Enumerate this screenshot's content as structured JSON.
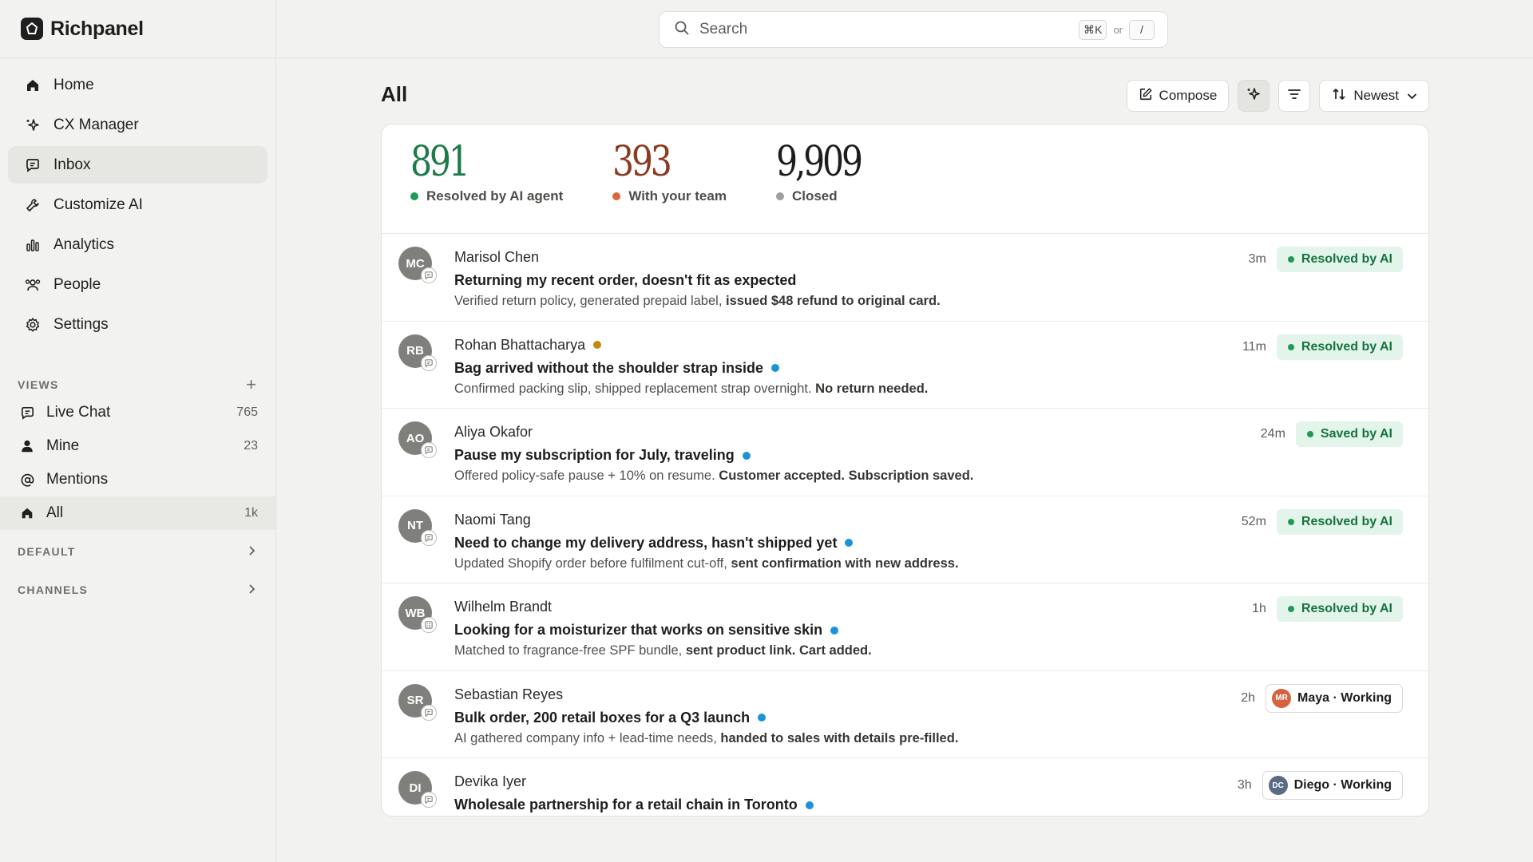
{
  "app": {
    "name": "Richpanel"
  },
  "sidebar": {
    "nav": [
      {
        "label": "Home",
        "icon": "home-icon"
      },
      {
        "label": "CX Manager",
        "icon": "sparkle-icon"
      },
      {
        "label": "Inbox",
        "icon": "chat-icon",
        "active": true
      },
      {
        "label": "Customize AI",
        "icon": "wrench-icon"
      },
      {
        "label": "Analytics",
        "icon": "bar-chart-icon"
      },
      {
        "label": "People",
        "icon": "people-icon"
      },
      {
        "label": "Settings",
        "icon": "gear-icon"
      }
    ],
    "views_title": "VIEWS",
    "views": [
      {
        "label": "Live Chat",
        "count": "765",
        "icon": "chat-icon"
      },
      {
        "label": "Mine",
        "count": "23",
        "icon": "person-icon"
      },
      {
        "label": "Mentions",
        "count": "",
        "icon": "at-icon"
      },
      {
        "label": "All",
        "count": "1k",
        "icon": "home-icon",
        "active": true
      }
    ],
    "default_title": "DEFAULT",
    "channels_title": "CHANNELS"
  },
  "search": {
    "placeholder": "Search",
    "shortcut": "⌘K",
    "or": "or",
    "alt_shortcut": "/"
  },
  "main": {
    "title": "All",
    "compose_label": "Compose",
    "sort_label": "Newest"
  },
  "stats": [
    {
      "value": "891",
      "label": "Resolved by AI agent",
      "color": "#1e7a4a",
      "dot": "#1f9a55"
    },
    {
      "value": "393",
      "label": "With your team",
      "color": "#8c3a22",
      "dot": "#d9683e"
    },
    {
      "value": "9,909",
      "label": "Closed",
      "color": "#1d1d1b",
      "dot": "#9e9e9a"
    }
  ],
  "conversations": [
    {
      "initials": "MC",
      "name": "Marisol Chen",
      "subject": "Returning my recent order, doesn't fit as expected",
      "summary": "Verified return policy, generated prepaid label,",
      "summary_bold": "issued $48 refund to original card.",
      "time": "3m",
      "status": "Resolved by AI",
      "status_type": "ai",
      "unread": false,
      "priority": false,
      "channel": "chat"
    },
    {
      "initials": "RB",
      "name": "Rohan Bhattacharya",
      "subject": "Bag arrived without the shoulder strap inside",
      "summary": "Confirmed packing slip, shipped replacement strap overnight.",
      "summary_bold": "No return needed.",
      "time": "11m",
      "status": "Resolved by AI",
      "status_type": "ai",
      "unread": true,
      "priority": true,
      "channel": "chat"
    },
    {
      "initials": "AO",
      "name": "Aliya Okafor",
      "subject": "Pause my subscription for July, traveling",
      "summary": "Offered policy-safe pause + 10% on resume.",
      "summary_bold": "Customer accepted. Subscription saved.",
      "time": "24m",
      "status": "Saved by AI",
      "status_type": "ai",
      "unread": true,
      "priority": false,
      "channel": "chat"
    },
    {
      "initials": "NT",
      "name": "Naomi Tang",
      "subject": "Need to change my delivery address, hasn't shipped yet",
      "summary": "Updated Shopify order before fulfilment cut-off,",
      "summary_bold": "sent confirmation with new address.",
      "time": "52m",
      "status": "Resolved by AI",
      "status_type": "ai",
      "unread": true,
      "priority": false,
      "channel": "chat"
    },
    {
      "initials": "WB",
      "name": "Wilhelm Brandt",
      "subject": "Looking for a moisturizer that works on sensitive skin",
      "summary": "Matched to fragrance-free SPF bundle,",
      "summary_bold": "sent product link. Cart added.",
      "time": "1h",
      "status": "Resolved by AI",
      "status_type": "ai",
      "unread": true,
      "priority": false,
      "channel": "form"
    },
    {
      "initials": "SR",
      "name": "Sebastian Reyes",
      "subject": "Bulk order, 200 retail boxes for a Q3 launch",
      "summary": "AI gathered company info + lead-time needs,",
      "summary_bold": "handed to sales with details pre-filled.",
      "time": "2h",
      "status": "Maya · Working",
      "status_type": "agent",
      "agent_initials": "MR",
      "agent_color": "#d5633f",
      "unread": true,
      "priority": false,
      "channel": "chat"
    },
    {
      "initials": "DI",
      "name": "Devika Iyer",
      "subject": "Wholesale partnership for a retail chain in Toronto",
      "summary": "",
      "summary_bold": "",
      "time": "3h",
      "status": "Diego · Working",
      "status_type": "agent",
      "agent_initials": "DC",
      "agent_color": "#5a6b86",
      "unread": true,
      "priority": false,
      "channel": "chat"
    }
  ]
}
